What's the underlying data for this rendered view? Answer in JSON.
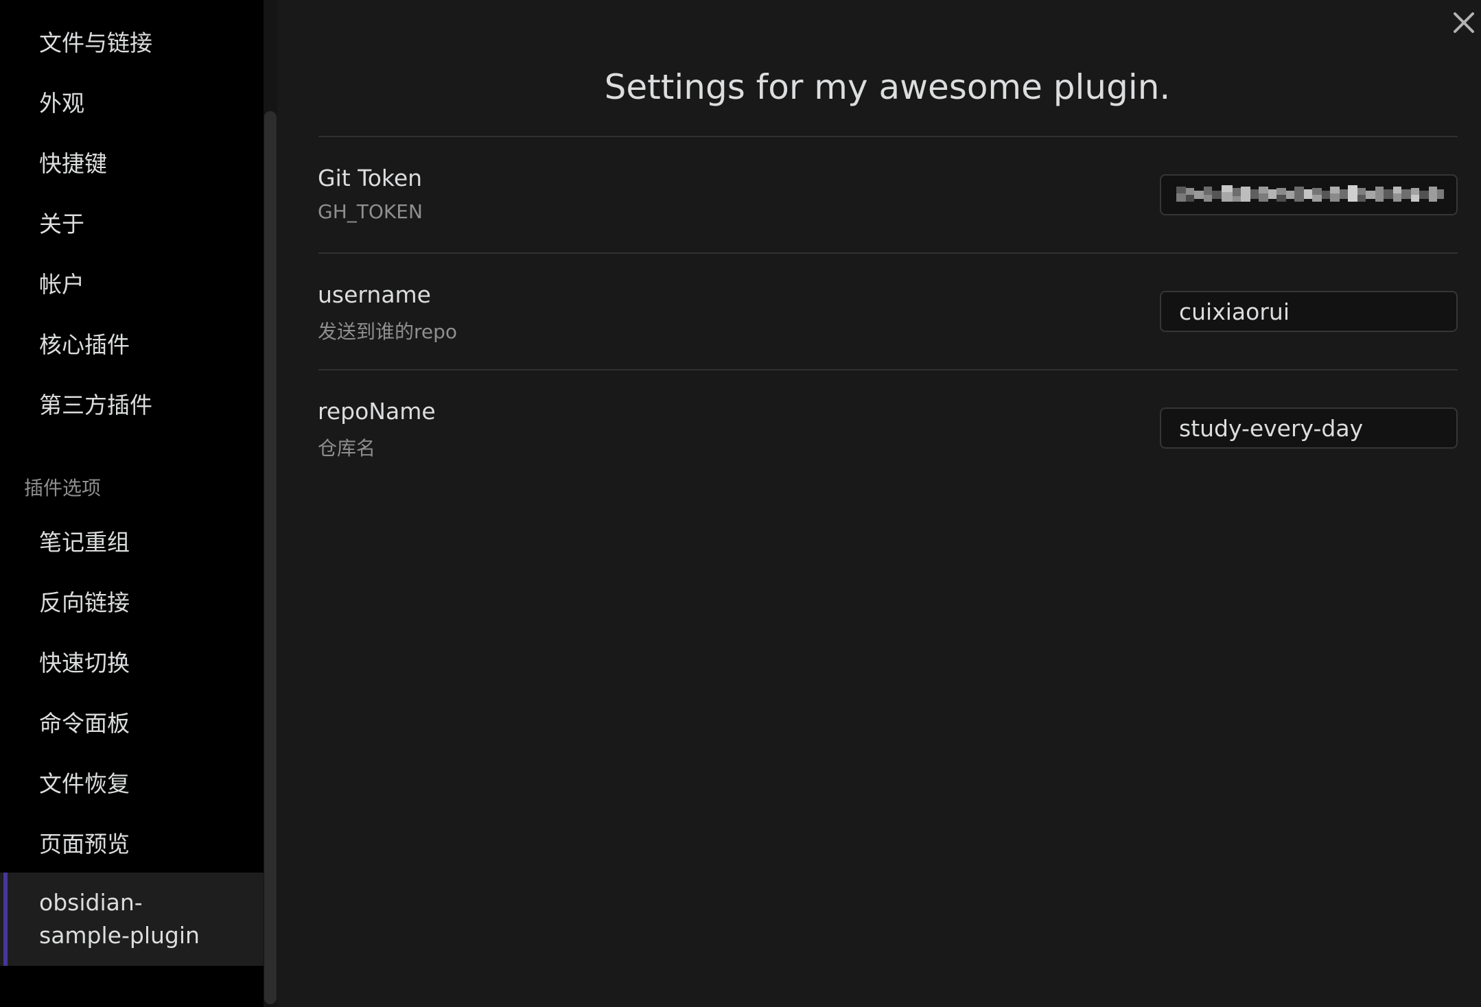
{
  "sidebar": {
    "core_items": [
      {
        "label": "文件与链接"
      },
      {
        "label": "外观"
      },
      {
        "label": "快捷键"
      },
      {
        "label": "关于"
      },
      {
        "label": "帐户"
      },
      {
        "label": "核心插件"
      },
      {
        "label": "第三方插件"
      }
    ],
    "plugin_section_label": "插件选项",
    "plugin_items": [
      {
        "label": "笔记重组"
      },
      {
        "label": "反向链接"
      },
      {
        "label": "快速切换"
      },
      {
        "label": "命令面板"
      },
      {
        "label": "文件恢复"
      },
      {
        "label": "页面预览"
      }
    ],
    "active_item": {
      "label": "obsidian-sample-plugin"
    }
  },
  "main": {
    "title": "Settings for my awesome plugin.",
    "settings": [
      {
        "name": "Git Token",
        "description": "GH_TOKEN",
        "value": "",
        "obscured": true
      },
      {
        "name": "username",
        "description": "发送到谁的repo",
        "value": "cuixiaorui"
      },
      {
        "name": "repoName",
        "description": "仓库名",
        "value": "study-every-day"
      }
    ]
  },
  "icons": {
    "close": "close-icon"
  },
  "colors": {
    "sidebar_bg": "#000000",
    "content_bg": "#191919",
    "accent": "#483699",
    "text": "#dcddde",
    "muted_text": "#8f8f8f"
  }
}
